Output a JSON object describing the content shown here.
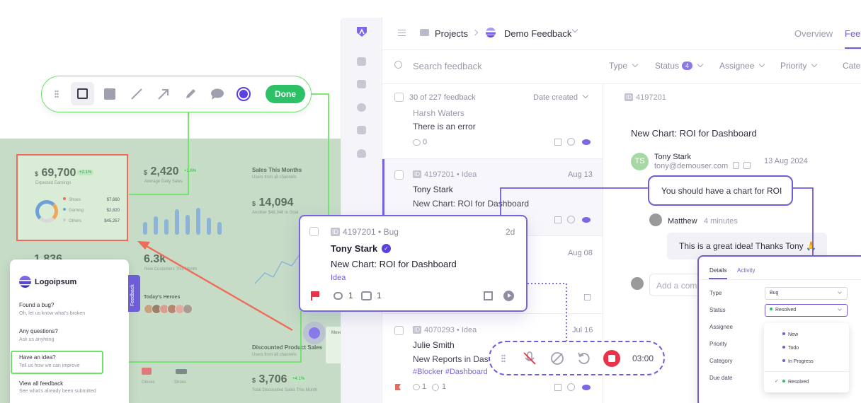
{
  "dashboard": {
    "card1": {
      "value": "69,700",
      "badge": "+2.1%",
      "label": "Expected Earnings",
      "legend": [
        {
          "name": "Shoes",
          "value": "$7,660"
        },
        {
          "name": "Gaming",
          "value": "$2,820"
        },
        {
          "name": "Others",
          "value": "$45,257"
        }
      ]
    },
    "card2": {
      "value": "2,420",
      "badge": "+2.6%",
      "label": "Average Daily Sales"
    },
    "card3": {
      "title": "Sales This Months",
      "sub": "Users from all channels",
      "value": "14,094",
      "label": "Another $48,346 to Goal"
    },
    "card4": {
      "value": "1,836"
    },
    "card5": {
      "value": "6.3k",
      "label": "New Customers This Month",
      "heroes_title": "Today's Heroes"
    },
    "card6": {
      "title": "Discounted Product Sales",
      "sub": "Users from all channels",
      "value": "3,706",
      "badge": "+4.1%",
      "label": "Total Discounted Sales This Month"
    },
    "categories": [
      "Gloves",
      "Shoes"
    ],
    "side_label": "Move"
  },
  "toolbar": {
    "done_label": "Done",
    "active_color": "#5b3fe0"
  },
  "app": {
    "breadcrumb": {
      "projects": "Projects",
      "board": "Demo Feedback"
    },
    "tabs": {
      "overview": "Overview",
      "feedback": "Feedback"
    },
    "search_placeholder": "Search feedback",
    "filters": {
      "type": "Type",
      "status": "Status",
      "status_count": "4",
      "assignee": "Assignee",
      "priority": "Priority",
      "category": "Category"
    },
    "list_header": {
      "count": "30 of 227 feedback",
      "sort": "Date created"
    },
    "rows": [
      {
        "name": "Harsh Waters",
        "title": "There is an error",
        "comments": "0"
      },
      {
        "id": "4197201",
        "type": "Idea",
        "date": "Aug 13",
        "name": "Tony Stark",
        "title": "New Chart: ROI for Dashboard"
      },
      {
        "date": "Aug 08"
      },
      {
        "id": "4070293",
        "type": "Idea",
        "date": "Jul 16",
        "name": "Julie Smith",
        "title": "New Reports in Dashboard",
        "tags": "#Blocker #Dashboard",
        "comments": "1",
        "votes": "1"
      }
    ],
    "detail": {
      "id": "4197201",
      "title": "New Chart: ROI for Dashboard",
      "author_initials": "TS",
      "author": "Tony Stark",
      "email": "tony@demouser.com",
      "date": "13 Aug 2024",
      "comment1": "You should have a chart for ROI",
      "reply_author": "Matthew",
      "reply_time": "4 minutes",
      "reply_text": "This is a great idea! Thanks Tony 🙏",
      "add_comment_placeholder": "Add a comment"
    }
  },
  "floating_card": {
    "id": "4197201",
    "type": "Bug",
    "age": "2d",
    "name": "Tony Stark",
    "title": "New Chart: ROI for Dashboard",
    "tag": "Idea",
    "comments": "1",
    "votes": "1"
  },
  "recorder": {
    "time": "03:00",
    "stop_color": "#e8334a"
  },
  "widget": {
    "brand": "Logoipsum",
    "tab": "Feedback",
    "items": [
      {
        "title": "Found a bug?",
        "sub": "Oh, let us know what's broken"
      },
      {
        "title": "Any questions?",
        "sub": "Ask us anyhting"
      },
      {
        "title": "Have an idea?",
        "sub": "Tell us how we can improve"
      },
      {
        "title": "View all feedback",
        "sub": "See what's already been submitted"
      }
    ]
  },
  "details_panel": {
    "tabs": [
      "Details",
      "Activity"
    ],
    "fields": {
      "type": "Type",
      "status": "Status",
      "assignee": "Assignee",
      "priority": "Priority",
      "category": "Category",
      "due_date": "Due date"
    },
    "type_value": "Bug",
    "status_value": "Resolved",
    "status_options": [
      "New",
      "Todo",
      "In Progress",
      "Resolved"
    ]
  },
  "colors": {
    "accent": "#6d5ed8",
    "highlight": "#6ee26a",
    "arrow": "#ef6b5a"
  }
}
